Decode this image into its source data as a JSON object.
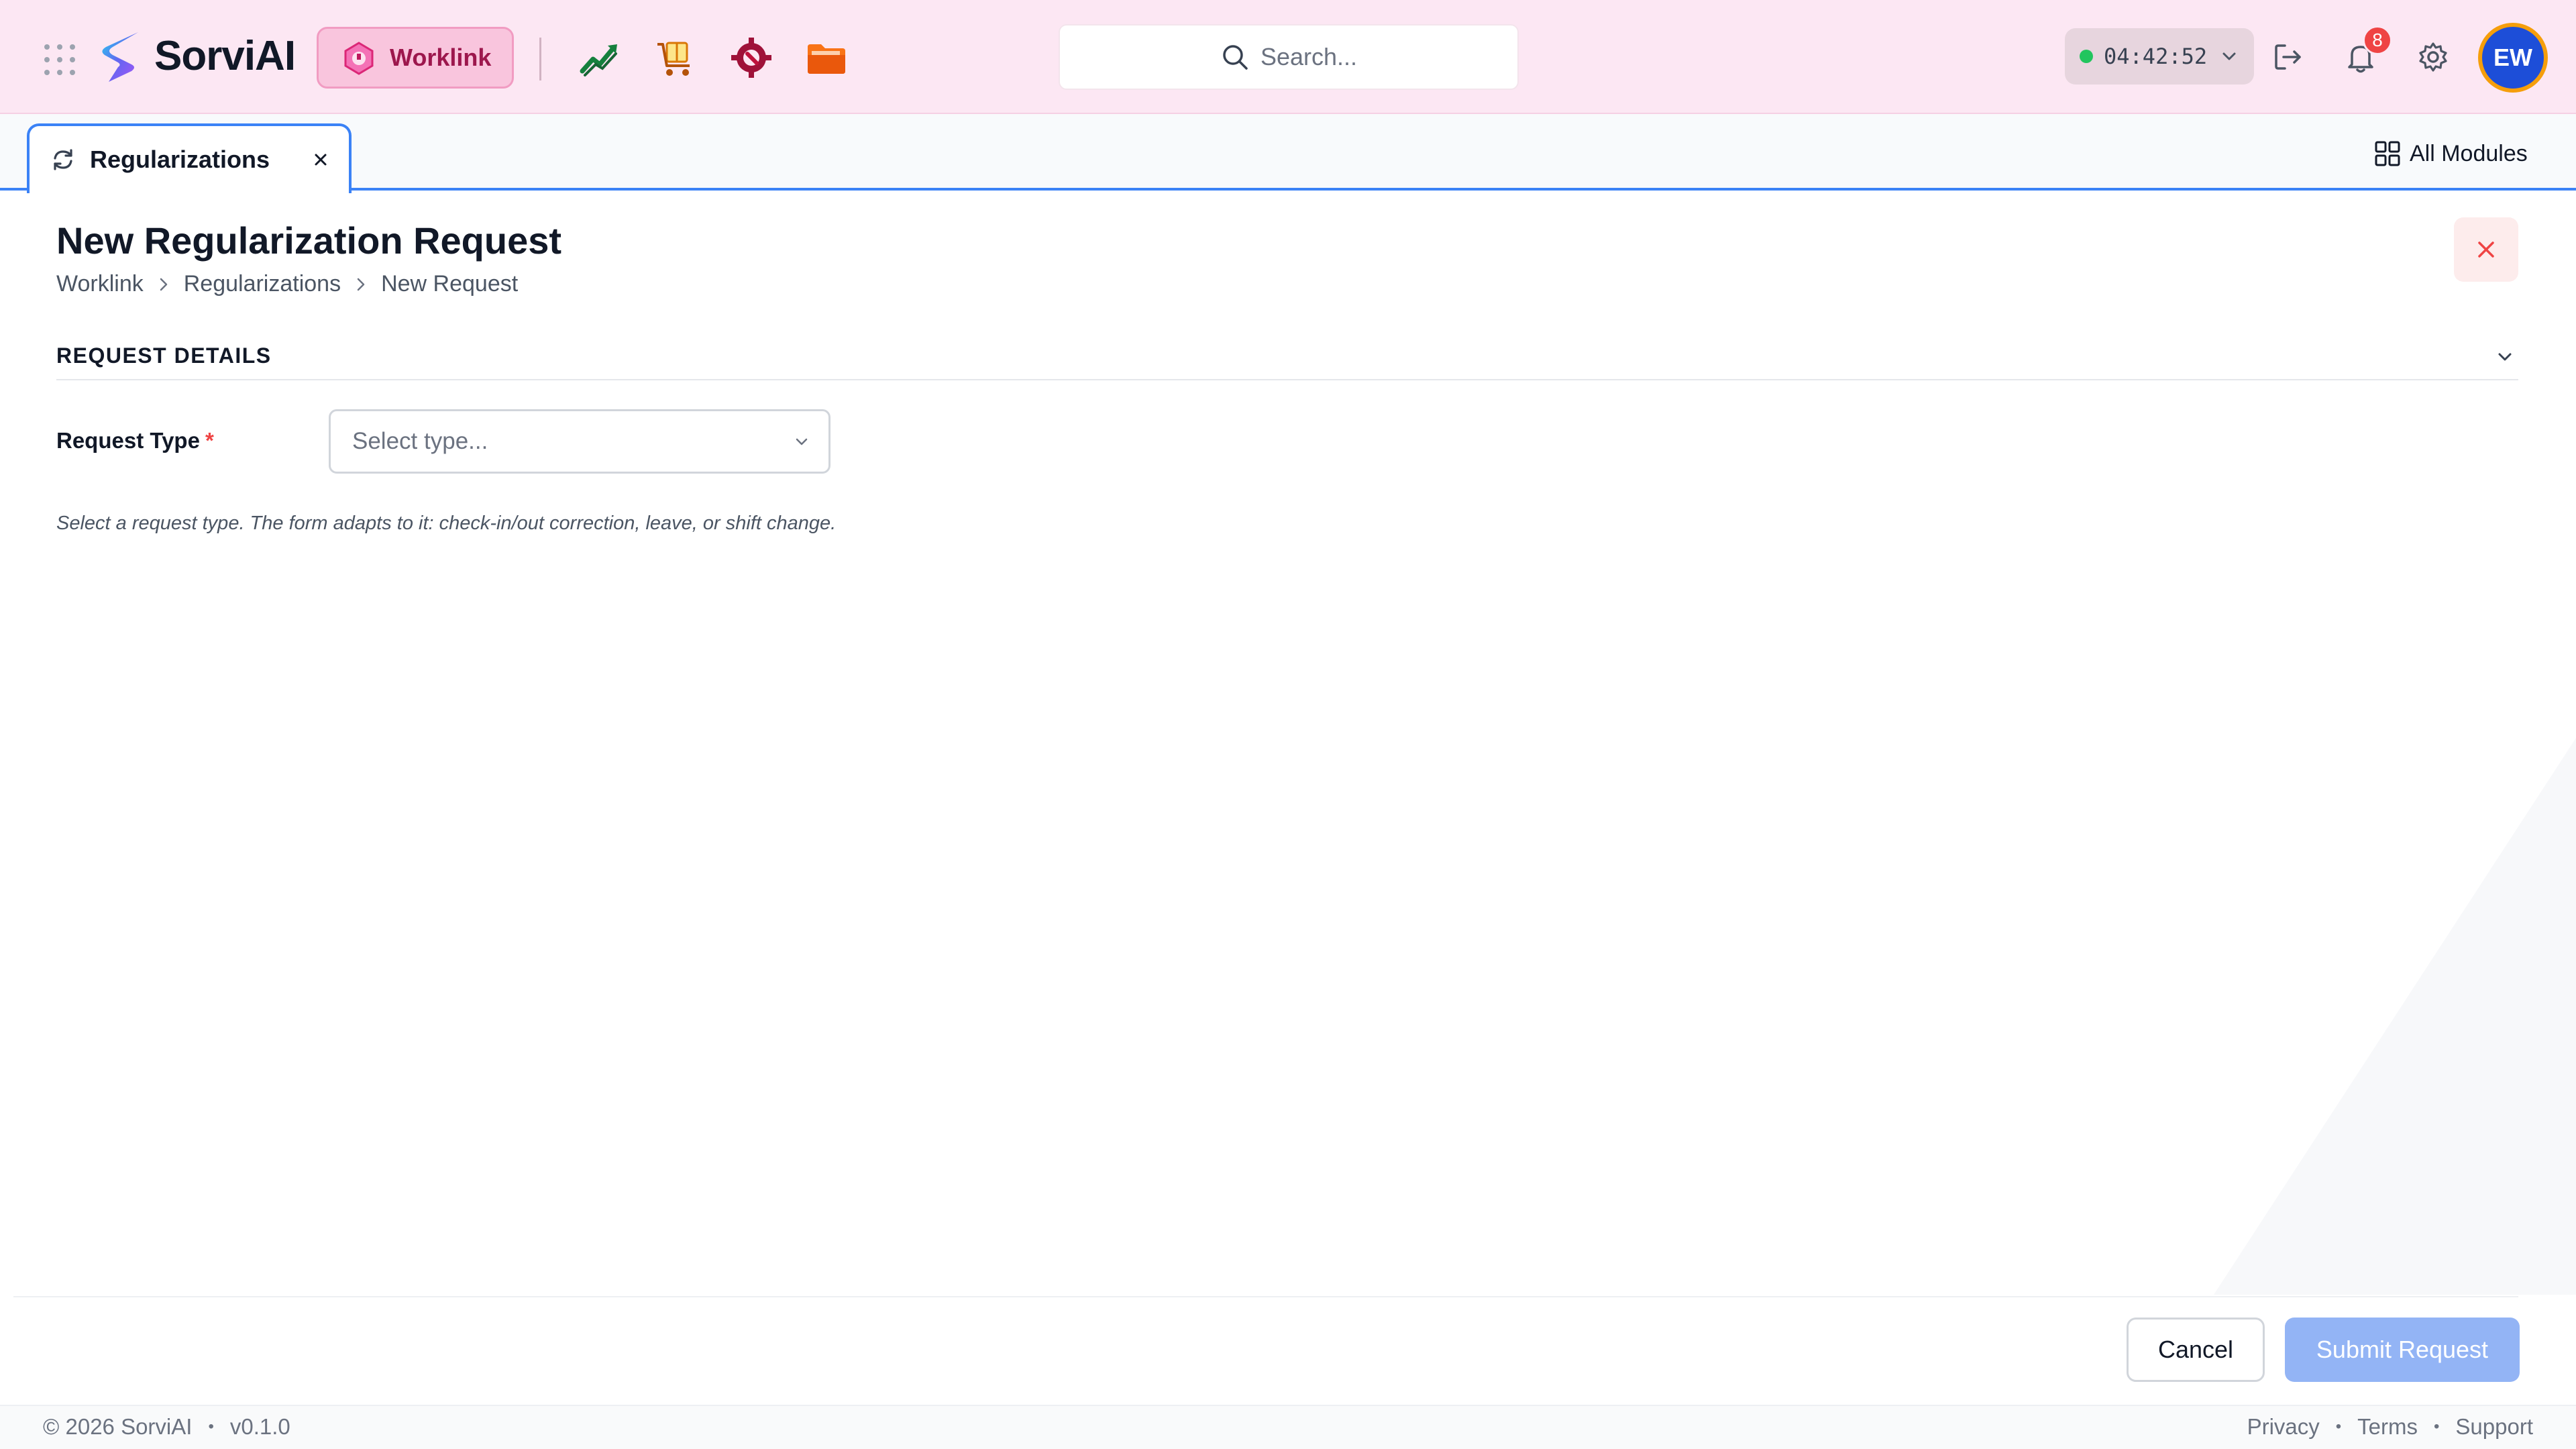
{
  "header": {
    "app_name": "SorviAI",
    "active_module": "Worklink",
    "apps": [
      {
        "name": "analytics",
        "icon": "chart-trend-icon"
      },
      {
        "name": "supply",
        "icon": "box-cart-icon"
      },
      {
        "name": "settings-app",
        "icon": "gear-wrench-icon"
      },
      {
        "name": "files",
        "icon": "folder-icon"
      }
    ],
    "search_placeholder": "Search...",
    "timer": "04:42:52",
    "notifications_count": "8",
    "avatar_initials": "EW"
  },
  "tabs": [
    {
      "label": "Regularizations",
      "icon": "refresh-icon"
    }
  ],
  "all_modules_label": "All Modules",
  "page": {
    "title": "New Regularization Request",
    "breadcrumb": [
      "Worklink",
      "Regularizations",
      "New Request"
    ]
  },
  "form": {
    "section_title": "REQUEST DETAILS",
    "request_type_label": "Request Type",
    "required_mark": "*",
    "request_type_placeholder": "Select type...",
    "hint": "Select a request type. The form adapts to it: check-in/out correction, leave, or shift change."
  },
  "actions": {
    "cancel_label": "Cancel",
    "submit_label": "Submit Request"
  },
  "footer": {
    "copyright": "© 2026 SorviAI",
    "version": "v0.1.0",
    "links": [
      "Privacy",
      "Terms",
      "Support"
    ]
  },
  "colors": {
    "header_bg": "#fce7f3",
    "accent": "#3b82f6",
    "module_pill": "#f9c5dd",
    "submit_disabled": "#93b4f5",
    "danger": "#ef4444",
    "online": "#22c55e"
  }
}
